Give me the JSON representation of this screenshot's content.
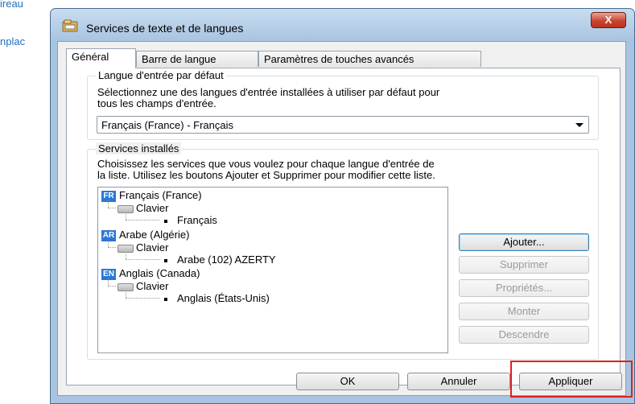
{
  "background": {
    "text1": "ireau",
    "text2": "nplac"
  },
  "window": {
    "title": "Services de texte et de langues",
    "close_label": "X"
  },
  "tabs": [
    {
      "label": "Général"
    },
    {
      "label": "Barre de langue"
    },
    {
      "label": "Paramètres de touches avancés"
    }
  ],
  "default_lang": {
    "group_title": "Langue d'entrée par défaut",
    "description_line1": "Sélectionnez une des langues d'entrée installées à utiliser par défaut pour",
    "description_line2": "tous les champs d'entrée.",
    "selected_value": "Français (France) - Français"
  },
  "services": {
    "group_title": "Services installés",
    "description_line1": "Choisissez les services que vous voulez pour chaque langue d'entrée de",
    "description_line2": "la liste. Utilisez les boutons Ajouter et Supprimer pour modifier cette liste.",
    "tree": [
      {
        "badge": "FR",
        "language": "Français (France)",
        "category": "Clavier",
        "layout": "Français"
      },
      {
        "badge": "AR",
        "language": "Arabe (Algérie)",
        "category": "Clavier",
        "layout": "Arabe (102) AZERTY"
      },
      {
        "badge": "EN",
        "language": "Anglais (Canada)",
        "category": "Clavier",
        "layout": "Anglais (États-Unis)"
      }
    ],
    "buttons": {
      "add": "Ajouter...",
      "remove": "Supprimer",
      "properties": "Propriétés...",
      "up": "Monter",
      "down": "Descendre"
    }
  },
  "footer": {
    "ok": "OK",
    "cancel": "Annuler",
    "apply": "Appliquer"
  },
  "colors": {
    "badge": "#2a78d5",
    "highlight_box": "#e02020"
  }
}
